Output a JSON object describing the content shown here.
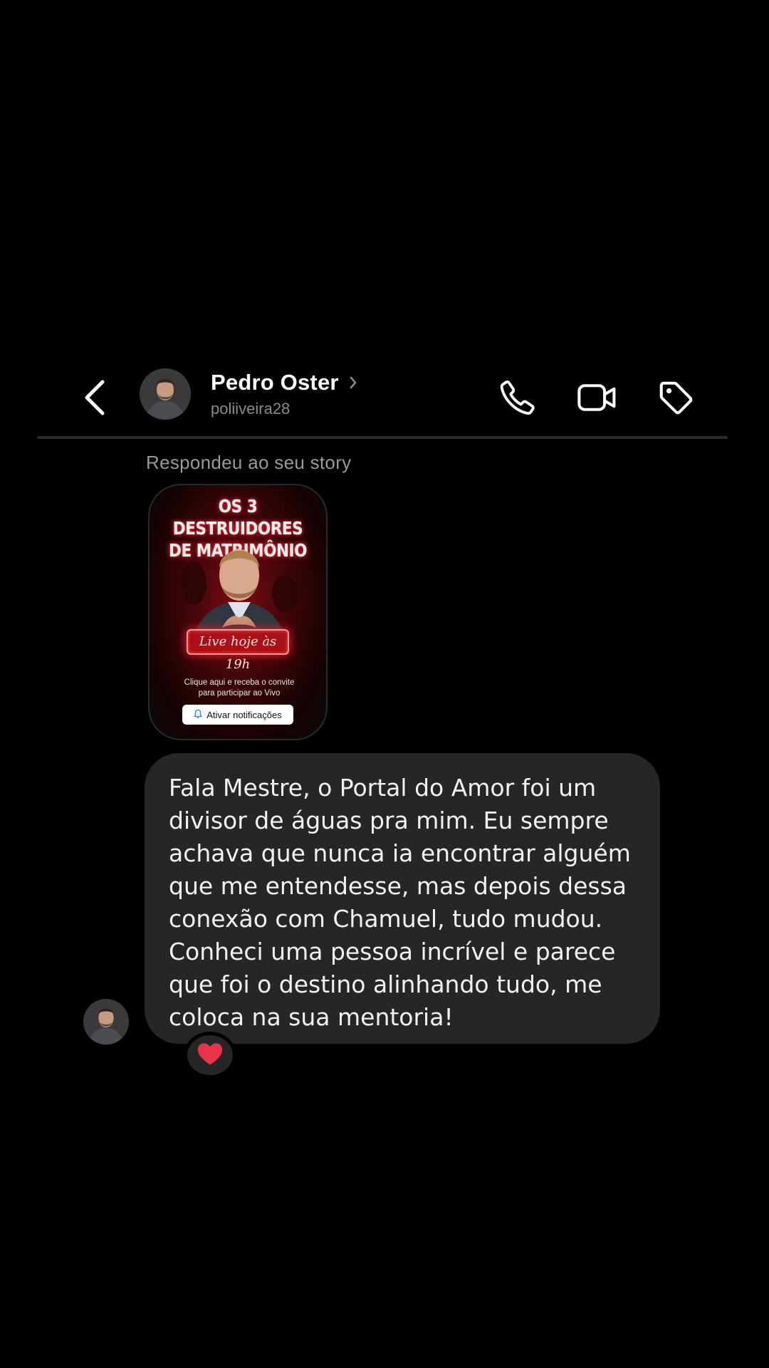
{
  "header": {
    "contact_name": "Pedro Oster",
    "contact_handle": "poliiveira28",
    "icons": [
      "back-arrow-icon",
      "avatar",
      "chevron-right-icon",
      "phone-icon",
      "video-call-icon",
      "tag-icon"
    ]
  },
  "story_reply": {
    "caption": "Respondeu ao seu story",
    "title_line1": "OS 3 DESTRUIDORES",
    "title_line2": "DE MATRIMÔNIO",
    "live_label": "Live hoje às 19h",
    "sub_line1": "Clique aqui e receba o convite",
    "sub_line2": "para participar ao Vivo",
    "notify_button": "Ativar notificações"
  },
  "message": {
    "text": "Fala Mestre, o Portal do Amor foi um divisor de águas pra mim. Eu sempre achava que nunca ia encontrar alguém que me entendesse, mas depois dessa conexão com Chamuel, tudo mudou. Conheci uma pessoa incrível e parece que foi o destino alinhando tudo, me coloca na sua mentoria!",
    "reaction": "heart-icon"
  },
  "colors": {
    "background": "#000000",
    "bubble": "#262626",
    "secondary_text": "#8a8a8a",
    "reaction_heart": "#e8344a"
  }
}
